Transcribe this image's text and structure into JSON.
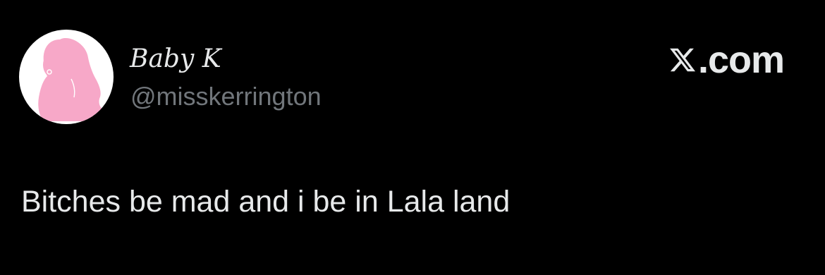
{
  "post": {
    "author": {
      "display_name": "Baby K",
      "handle": "@misskerrington",
      "avatar_icon": "pink-woman-silhouette-icon"
    },
    "brand": {
      "logo_icon": "x-logo-icon",
      "text": ".com"
    },
    "text": "Bitches be mad and i be in Lala land"
  },
  "colors": {
    "background": "#000000",
    "primary_text": "#e7e9ea",
    "secondary_text": "#71767b",
    "avatar_background": "#ffffff",
    "avatar_silhouette": "#f7a8c8"
  }
}
